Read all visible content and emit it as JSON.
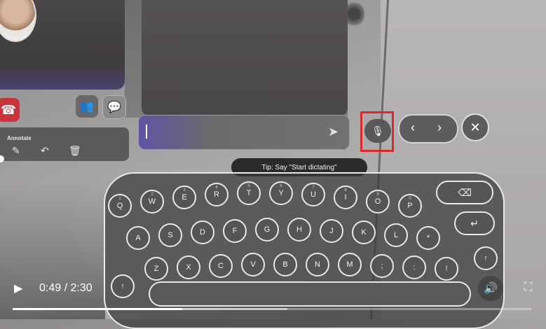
{
  "call": {
    "hangup_icon": "phone-icon",
    "people_icon": "people-icon",
    "chat_icon": "chat-icon"
  },
  "annotate": {
    "label": "Annotate",
    "tools": [
      "pen-icon",
      "undo-icon",
      "trash-icon"
    ]
  },
  "input": {
    "send_icon": "send-icon"
  },
  "controls": {
    "mic_icon": "microphone-icon",
    "prev_glyph": "‹",
    "next_glyph": "›",
    "close_glyph": "✕"
  },
  "tip": "Tip: Say \"Start dictating\"",
  "keyboard": {
    "row1": [
      {
        "k": "Q",
        "n": "1"
      },
      {
        "k": "W",
        "n": "2"
      },
      {
        "k": "E",
        "n": "3"
      },
      {
        "k": "R",
        "n": "4"
      },
      {
        "k": "T",
        "n": "5"
      },
      {
        "k": "Y",
        "n": "6"
      },
      {
        "k": "U",
        "n": "7"
      },
      {
        "k": "I",
        "n": "8"
      },
      {
        "k": "O",
        "n": "9"
      },
      {
        "k": "P",
        "n": "0"
      }
    ],
    "row2": [
      "A",
      "S",
      "D",
      "F",
      "G",
      "H",
      "J",
      "K",
      "L",
      "*"
    ],
    "row3": [
      "Z",
      "X",
      "C",
      "V",
      "B",
      "N",
      "M",
      ";",
      ":",
      "!"
    ],
    "backspace": "⌫",
    "enter": "↵",
    "shift": "↑"
  },
  "video": {
    "time": "0:49 / 2:30",
    "progress": 0.327,
    "buffered": 0.53
  },
  "colors": {
    "highlight": "#d82b2b",
    "hangup": "#c9343b"
  }
}
